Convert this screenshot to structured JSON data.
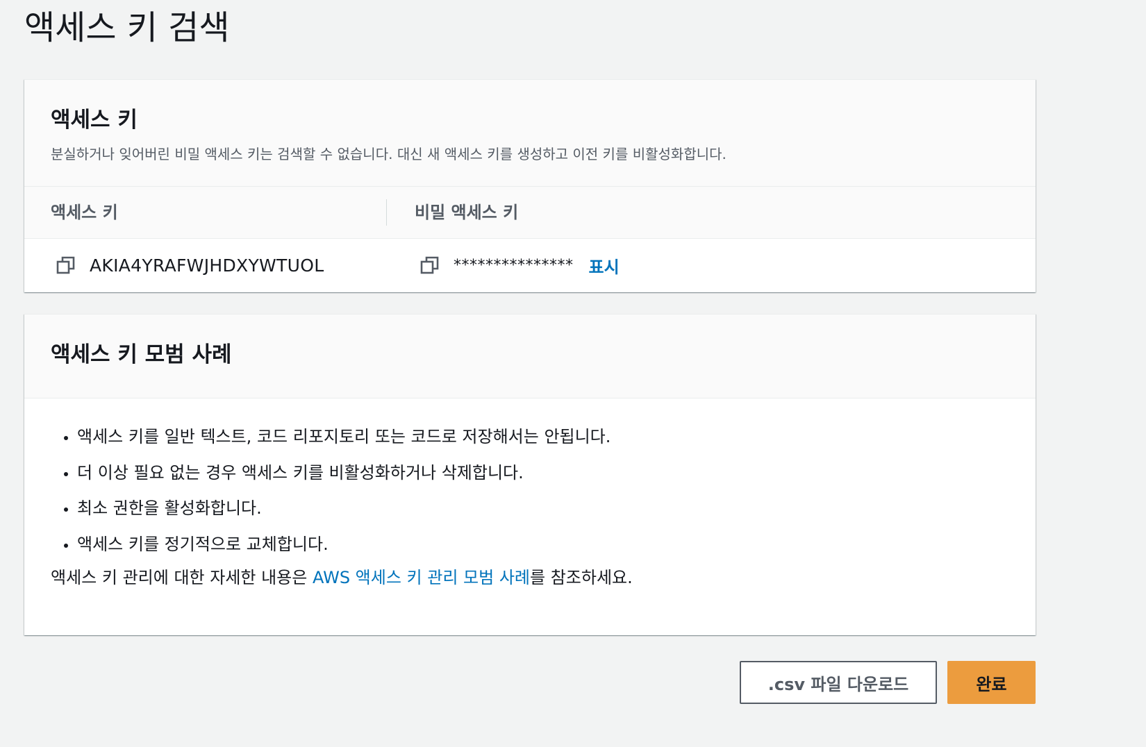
{
  "page": {
    "title": "액세스 키 검색"
  },
  "access_key_card": {
    "title": "액세스 키",
    "description": "분실하거나 잊어버린 비밀 액세스 키는 검색할 수 없습니다. 대신 새 액세스 키를 생성하고 이전 키를 비활성화합니다.",
    "columns": [
      "액세스 키",
      "비밀 액세스 키"
    ],
    "access_key_value": "AKIA4YRAFWJHDXYWTUOL",
    "secret_key_masked": "***************",
    "show_label": "표시",
    "icons": [
      "copy-icon",
      "copy-icon"
    ]
  },
  "best_practices_card": {
    "title": "액세스 키 모범 사례",
    "items": [
      "액세스 키를 일반 텍스트, 코드 리포지토리 또는 코드로 저장해서는 안됩니다.",
      "더 이상 필요 없는 경우 액세스 키를 비활성화하거나 삭제합니다.",
      "최소 권한을 활성화합니다.",
      "액세스 키를 정기적으로 교체합니다."
    ],
    "more_info_prefix": "액세스 키 관리에 대한 자세한 내용은 ",
    "more_info_link": "AWS 액세스 키 관리 모범 사례",
    "more_info_suffix": "를 참조하세요."
  },
  "actions": {
    "download_label": ".csv 파일 다운로드",
    "done_label": "완료"
  },
  "colors": {
    "link": "#0073bb",
    "primary_button": "#ec9c3e",
    "background": "#f2f3f3"
  }
}
